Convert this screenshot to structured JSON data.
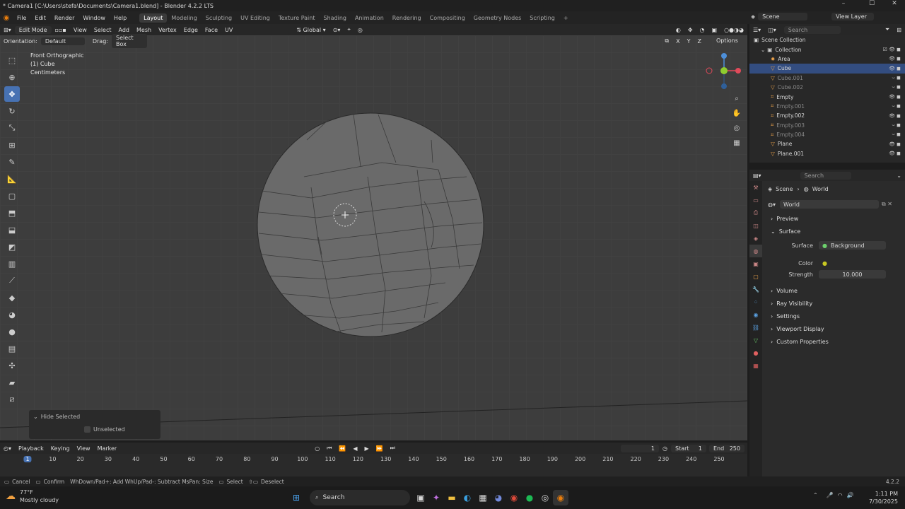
{
  "window": {
    "title": "* Camera1 [C:\\Users\\stefa\\Documents\\Camera1.blend] - Blender 4.2.2 LTS"
  },
  "menu": {
    "file": "File",
    "edit": "Edit",
    "render": "Render",
    "window": "Window",
    "help": "Help"
  },
  "workspaces": [
    "Layout",
    "Modeling",
    "Sculpting",
    "UV Editing",
    "Texture Paint",
    "Shading",
    "Animation",
    "Rendering",
    "Compositing",
    "Geometry Nodes",
    "Scripting"
  ],
  "scene_field": "Scene",
  "viewlayer_field": "View Layer",
  "viewport_header": {
    "mode": "Edit Mode",
    "view": "View",
    "select": "Select",
    "add": "Add",
    "mesh": "Mesh",
    "vertex": "Vertex",
    "edge": "Edge",
    "face": "Face",
    "uv": "UV",
    "transform": "Global",
    "options": "Options"
  },
  "viewport_header2": {
    "orientation_label": "Orientation:",
    "orientation_value": "Default",
    "drag_label": "Drag:",
    "drag_value": "Select Box",
    "axes": [
      "X",
      "Y",
      "Z"
    ]
  },
  "viewport_info": {
    "line1": "Front Orthographic",
    "line2": "(1) Cube",
    "line3": "Centimeters"
  },
  "last_operator": {
    "title": "Hide Selected",
    "option": "Unselected"
  },
  "timeline": {
    "playback": "Playback",
    "keying": "Keying",
    "view": "View",
    "marker": "Marker",
    "current_frame": "1",
    "start_label": "Start",
    "start": "1",
    "end_label": "End",
    "end": "250",
    "ticks": [
      "1",
      "10",
      "20",
      "30",
      "40",
      "50",
      "60",
      "70",
      "80",
      "90",
      "100",
      "110",
      "120",
      "130",
      "140",
      "150",
      "160",
      "170",
      "180",
      "190",
      "200",
      "210",
      "220",
      "230",
      "240",
      "250"
    ]
  },
  "statusbar": {
    "cancel": "Cancel",
    "confirm": "Confirm",
    "wheel": "WhDown/Pad+: Add  WhUp/Pad-: Subtract  MsPan: Size",
    "select": "Select",
    "deselect": "Deselect",
    "version": "4.2.2"
  },
  "outliner": {
    "search": "Search",
    "scene_collection": "Scene Collection",
    "collection": "Collection",
    "items": [
      {
        "name": "Area",
        "dim": false,
        "selected": false,
        "icon": "light-icon"
      },
      {
        "name": "Cube",
        "dim": false,
        "selected": true,
        "icon": "mesh-icon"
      },
      {
        "name": "Cube.001",
        "dim": true,
        "selected": false,
        "icon": "mesh-icon"
      },
      {
        "name": "Cube.002",
        "dim": true,
        "selected": false,
        "icon": "mesh-icon"
      },
      {
        "name": "Empty",
        "dim": false,
        "selected": false,
        "icon": "empty-icon"
      },
      {
        "name": "Empty.001",
        "dim": true,
        "selected": false,
        "icon": "empty-icon"
      },
      {
        "name": "Empty.002",
        "dim": false,
        "selected": false,
        "icon": "empty-icon"
      },
      {
        "name": "Empty.003",
        "dim": true,
        "selected": false,
        "icon": "empty-icon"
      },
      {
        "name": "Empty.004",
        "dim": true,
        "selected": false,
        "icon": "empty-icon"
      },
      {
        "name": "Plane",
        "dim": false,
        "selected": false,
        "icon": "mesh-icon"
      },
      {
        "name": "Plane.001",
        "dim": false,
        "selected": false,
        "icon": "mesh-icon"
      }
    ]
  },
  "properties": {
    "search": "Search",
    "breadcrumb_scene": "Scene",
    "breadcrumb_world": "World",
    "world_name": "World",
    "sections": {
      "preview": "Preview",
      "surface": "Surface",
      "volume": "Volume",
      "ray_visibility": "Ray Visibility",
      "settings": "Settings",
      "viewport_display": "Viewport Display",
      "custom_properties": "Custom Properties"
    },
    "surface_label": "Surface",
    "surface_value": "Background",
    "color_label": "Color",
    "strength_label": "Strength",
    "strength_value": "10.000"
  },
  "taskbar": {
    "weather_temp": "77°F",
    "weather_desc": "Mostly cloudy",
    "search": "Search",
    "time": "1:11 PM",
    "date": "7/30/2025"
  },
  "colors": {
    "accent": "#4772b3",
    "selected_row": "#334d80",
    "viewport_bg": "#3d3d3d"
  }
}
